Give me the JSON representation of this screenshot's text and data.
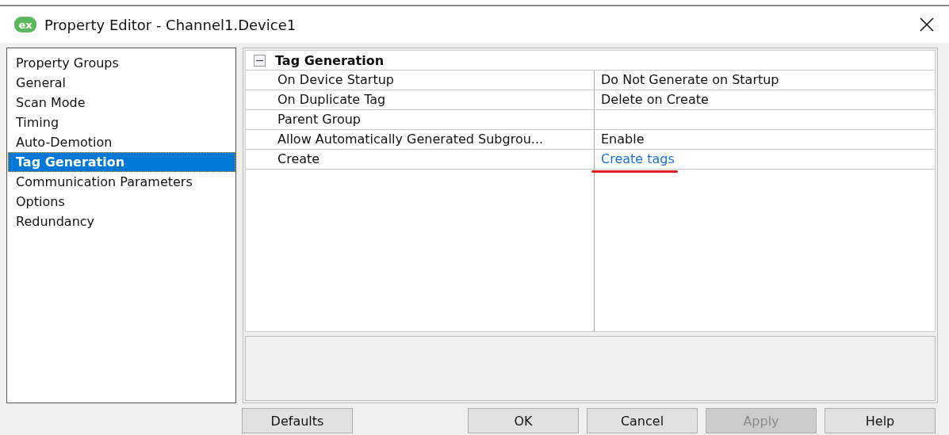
{
  "window": {
    "title": "Property Editor - Channel1.Device1",
    "app_logo": "ex"
  },
  "sidebar": {
    "items": [
      {
        "label": "Property Groups",
        "selected": false
      },
      {
        "label": "General",
        "selected": false
      },
      {
        "label": "Scan Mode",
        "selected": false
      },
      {
        "label": "Timing",
        "selected": false
      },
      {
        "label": "Auto-Demotion",
        "selected": false
      },
      {
        "label": "Tag Generation",
        "selected": true
      },
      {
        "label": "Communication Parameters",
        "selected": false
      },
      {
        "label": "Options",
        "selected": false
      },
      {
        "label": "Redundancy",
        "selected": false
      }
    ]
  },
  "property_grid": {
    "group": {
      "label": "Tag Generation",
      "expanded": true
    },
    "rows": [
      {
        "name": "On Device Startup",
        "value": "Do Not Generate on Startup",
        "kind": "text",
        "marked": false
      },
      {
        "name": "On Duplicate Tag",
        "value": "Delete on Create",
        "kind": "text",
        "marked": false
      },
      {
        "name": "Parent Group",
        "kind": "text",
        "marked": false
      },
      {
        "name": "Allow Automatically Generated Subgrou...",
        "value": "Enable",
        "kind": "text",
        "marked": false
      },
      {
        "name": "Create",
        "value": "Create tags",
        "kind": "link",
        "marked": true
      }
    ]
  },
  "buttons": [
    {
      "label": "Defaults",
      "disabled": false
    },
    {
      "label": "OK",
      "disabled": false
    },
    {
      "label": "Cancel",
      "disabled": false
    },
    {
      "label": "Apply",
      "disabled": true
    },
    {
      "label": "Help",
      "disabled": false
    }
  ]
}
